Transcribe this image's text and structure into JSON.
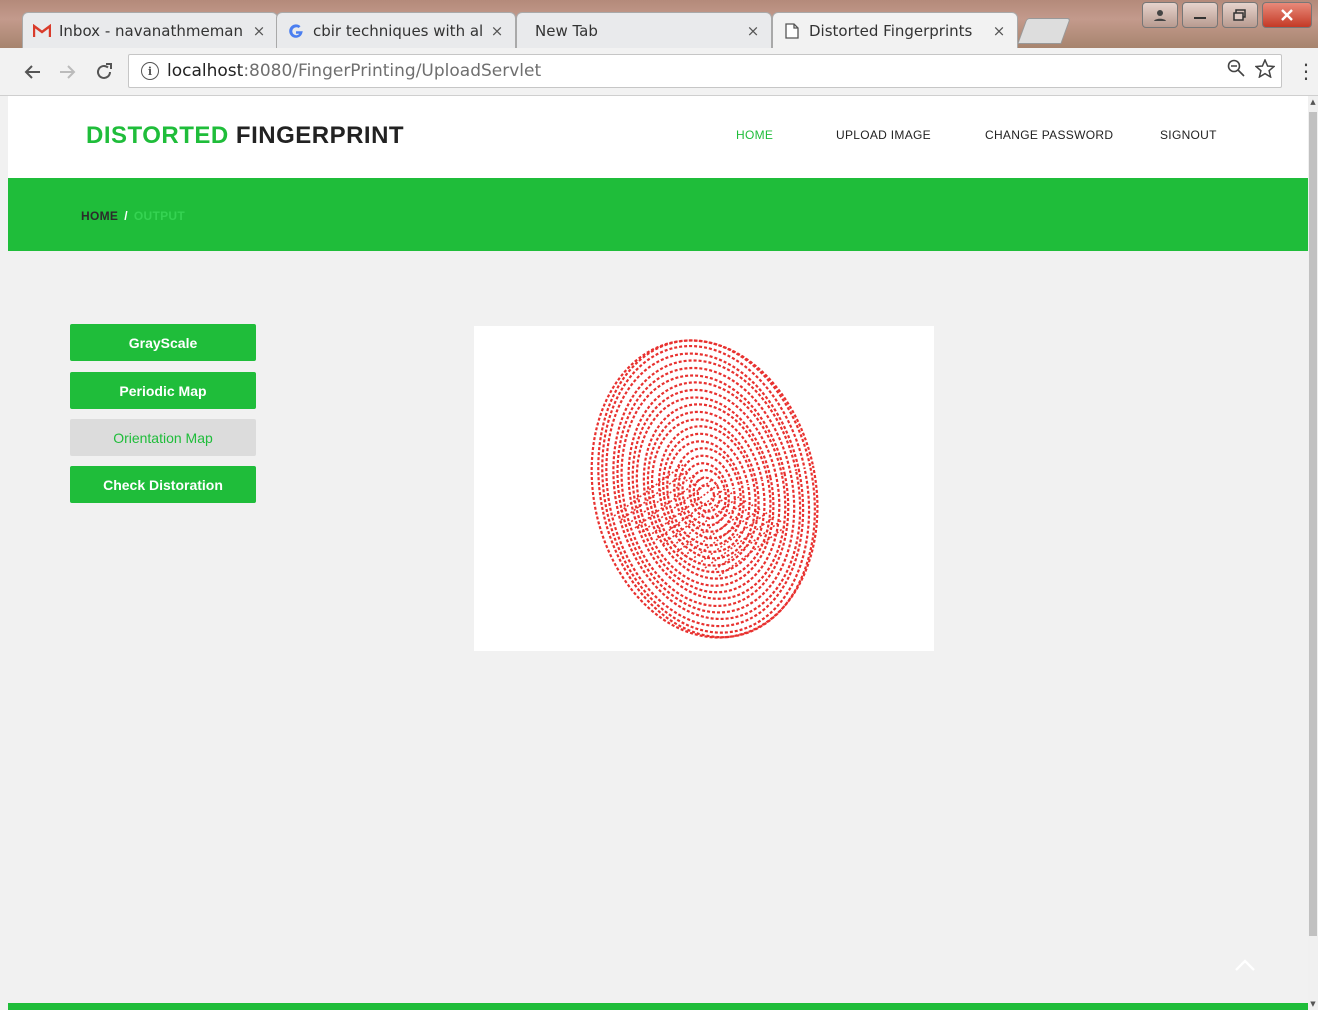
{
  "browser": {
    "tabs": [
      {
        "title": "Inbox - navanathmeman",
        "icon": "gmail-icon"
      },
      {
        "title": "cbir techniques with alog",
        "icon": "google-icon"
      },
      {
        "title": "New Tab",
        "icon": ""
      },
      {
        "title": "Distorted Fingerprints",
        "icon": "page-icon",
        "active": true
      }
    ],
    "close_glyph": "×",
    "url_host": "localhost",
    "url_path": ":8080/FingerPrinting/UploadServlet"
  },
  "site": {
    "brand_accent": "DISTORTED",
    "brand_main": "FINGERPRINT",
    "nav": [
      "HOME",
      "UPLOAD IMAGE",
      "CHANGE PASSWORD",
      "SIGNOUT"
    ],
    "breadcrumb": {
      "home": "HOME",
      "sep": "/",
      "current": "OUTPUT"
    },
    "actions": [
      "GrayScale",
      "Periodic Map",
      "Orientation Map",
      "Check Distoration"
    ],
    "accent_color": "#1fbd3a",
    "fingerprint_color": "#e8312f"
  }
}
